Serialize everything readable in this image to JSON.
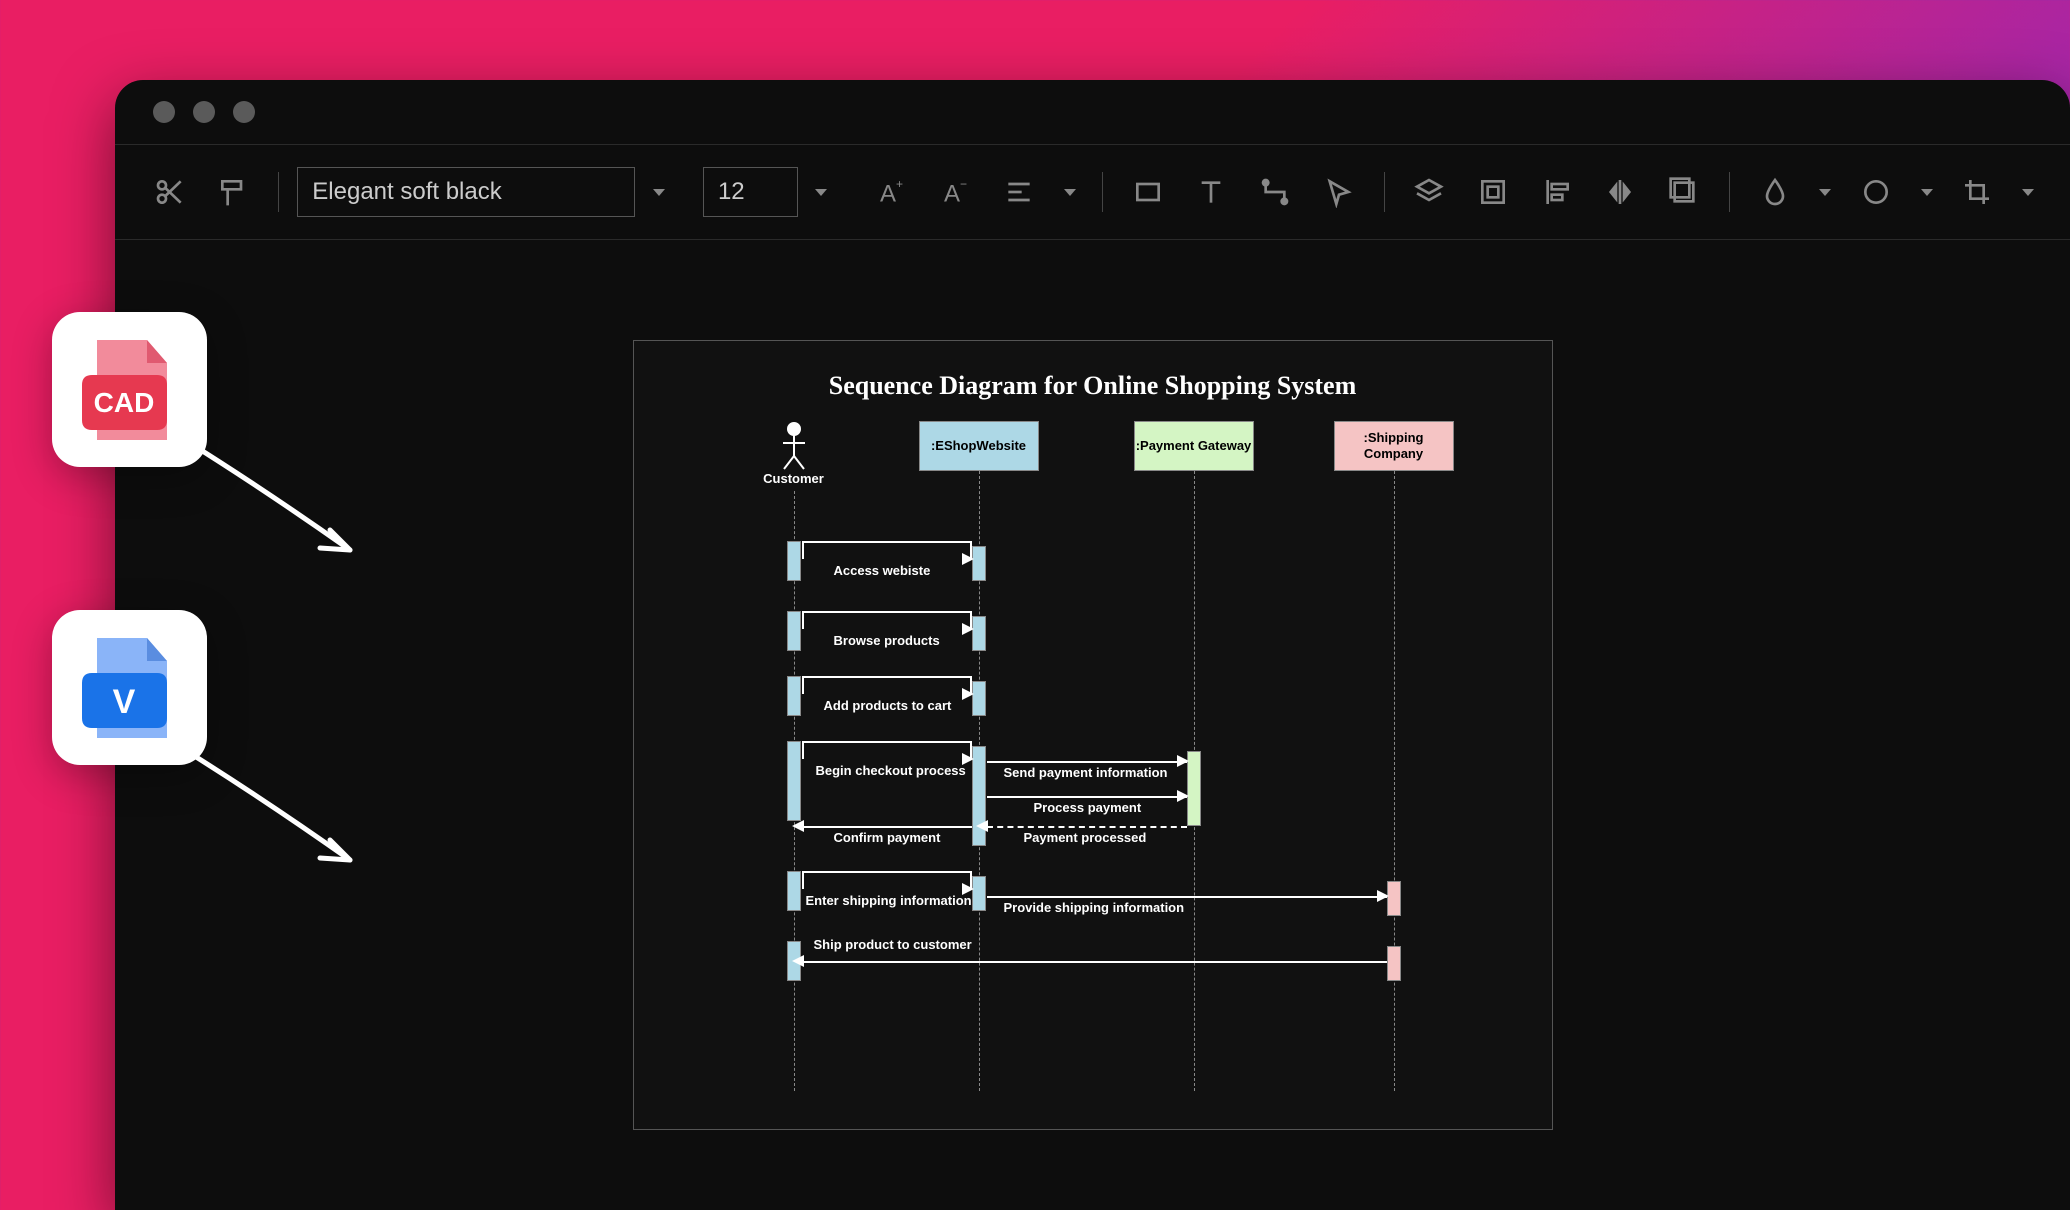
{
  "toolbar": {
    "font_name": "Elegant soft black",
    "font_size": "12"
  },
  "diagram": {
    "title": "Sequence Diagram for Online Shopping System",
    "actors": {
      "customer": "Customer",
      "eshop": ":EShopWebsite",
      "payment": ":Payment Gateway",
      "shipping": ":Shipping Company"
    },
    "messages": {
      "m1": "Access webiste",
      "m2": "Browse products",
      "m3": "Add products to cart",
      "m4": "Begin checkout process",
      "m5": "Send payment information",
      "m6": "Process payment",
      "m7": "Payment processed",
      "m8": "Confirm payment",
      "m9": "Enter shipping information",
      "m10": "Provide shipping information",
      "m11": "Ship product to customer"
    }
  },
  "colors": {
    "eshop": "#add8e6",
    "payment": "#d4f5c4",
    "shipping": "#f5c4c4"
  },
  "overlay": {
    "cad_label": "CAD",
    "visio_label": "V"
  }
}
